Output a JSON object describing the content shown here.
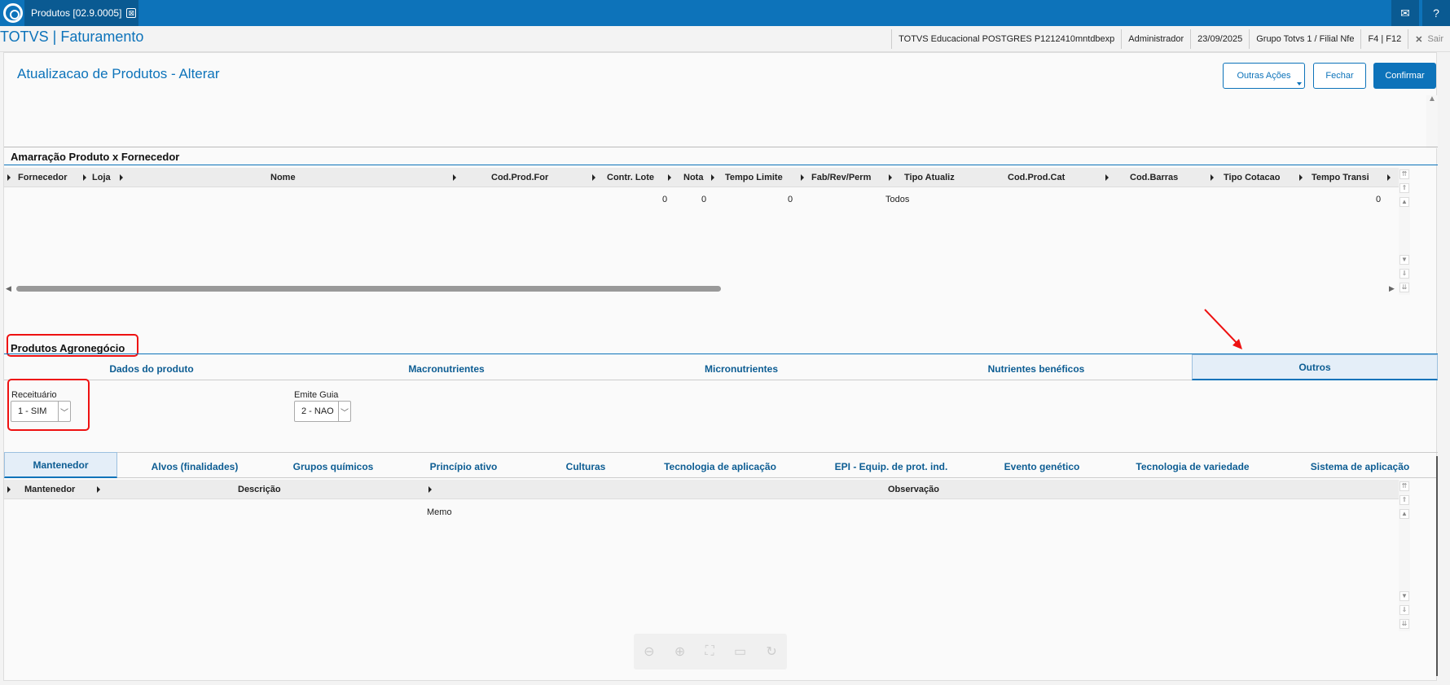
{
  "window": {
    "tab_title": "Produtos [02.9.0005]",
    "tab_close": "⊠",
    "mail_icon": "✉",
    "help_icon": "?"
  },
  "header": {
    "app_title": "TOTVS | Faturamento",
    "info": [
      "TOTVS Educacional POSTGRES P1212410mntdbexp",
      "Administrador",
      "23/09/2025",
      "Grupo Totvs 1 / Filial Nfe",
      "F4 | F12"
    ],
    "sair_icon": "✕",
    "sair": "Sair"
  },
  "page": {
    "title": "Atualizacao de Produtos - Alterar",
    "buttons": {
      "outras": "Outras Ações",
      "fechar": "Fechar",
      "confirmar": "Confirmar"
    }
  },
  "fornecedor": {
    "title": "Amarração Produto x Fornecedor",
    "columns": [
      "Fornecedor",
      "Loja",
      "Nome",
      "Cod.Prod.For",
      "Contr. Lote",
      "Nota",
      "Tempo Limite",
      "Fab/Rev/Perm",
      "Tipo Atualiz",
      "Cod.Prod.Cat",
      "Cod.Barras",
      "Tipo Cotacao",
      "Tempo Transi"
    ],
    "row": {
      "contr_lote": "0",
      "nota": "0",
      "tempo_limite": "0",
      "tipo_atualiz": "Todos",
      "tempo_transi": "0"
    }
  },
  "agro": {
    "title": "Produtos Agronegócio",
    "tabs": [
      "Dados do produto",
      "Macronutrientes",
      "Micronutrientes",
      "Nutrientes benéficos",
      "Outros"
    ],
    "receituario_label": "Receituário",
    "receituario_value": "1 - SIM",
    "emite_label": "Emite Guia",
    "emite_value": "2 - NAO"
  },
  "subtabs": [
    "Mantenedor",
    "Alvos (finalidades)",
    "Grupos químicos",
    "Princípio ativo",
    "Culturas",
    "Tecnologia de aplicação",
    "EPI - Equip. de prot. ind.",
    "Evento genético",
    "Tecnologia de variedade",
    "Sistema de aplicação"
  ],
  "mantenedor": {
    "columns": [
      "Mantenedor",
      "Descrição",
      "Observação"
    ],
    "row_value": "Memo"
  },
  "colors": {
    "accent": "#0d73ba",
    "highlight": "#e11"
  }
}
